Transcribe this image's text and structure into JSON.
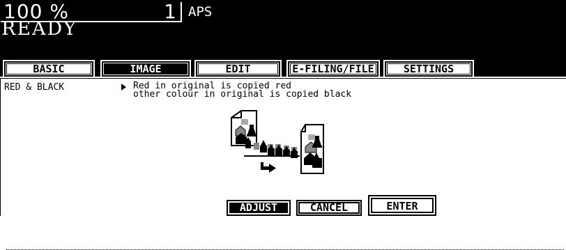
{
  "status": {
    "zoom": "100  %",
    "copies": "1",
    "paper": "APS",
    "state": "READY"
  },
  "tabs": [
    {
      "label": "BASIC",
      "active": false
    },
    {
      "label": "IMAGE",
      "active": true
    },
    {
      "label": "EDIT",
      "active": false
    },
    {
      "label": "E-FILING/FILE",
      "active": false
    },
    {
      "label": "SETTINGS",
      "active": false
    }
  ],
  "function": {
    "name": "RED & BLACK",
    "description_line1": "Red in original is copied red",
    "description_line2": "other colour in original is copied black"
  },
  "illustration": {
    "icon": "red-black-copy-illustration-icon"
  },
  "buttons": {
    "adjust": "ADJUST",
    "cancel": "CANCEL",
    "enter": "ENTER"
  }
}
